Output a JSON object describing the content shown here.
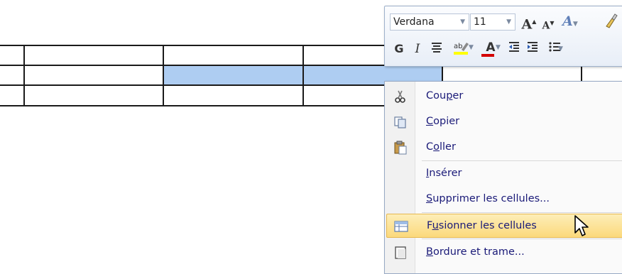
{
  "toolbar": {
    "font_name": "Verdana",
    "font_size": "11",
    "grow_font": "A",
    "shrink_font": "A",
    "styles_btn": "A",
    "bold": "G",
    "italic": "I",
    "font_color": "A"
  },
  "menu": {
    "items": [
      {
        "pre": "Cou",
        "ul": "p",
        "post": "er"
      },
      {
        "pre": "",
        "ul": "C",
        "post": "opier"
      },
      {
        "pre": "C",
        "ul": "o",
        "post": "ller"
      },
      {
        "pre": "",
        "ul": "I",
        "post": "nsérer"
      },
      {
        "pre": "",
        "ul": "S",
        "post": "upprimer les cellules..."
      },
      {
        "pre": "F",
        "ul": "u",
        "post": "sionner les cellules"
      },
      {
        "pre": "",
        "ul": "B",
        "post": "ordure et trame..."
      }
    ]
  },
  "colors": {
    "selection": "#aecdf2",
    "menu_text": "#1a1a78",
    "highlight": "#fbd97c",
    "font_color_bar": "#d40000",
    "highlight_bar": "#ffff00"
  }
}
